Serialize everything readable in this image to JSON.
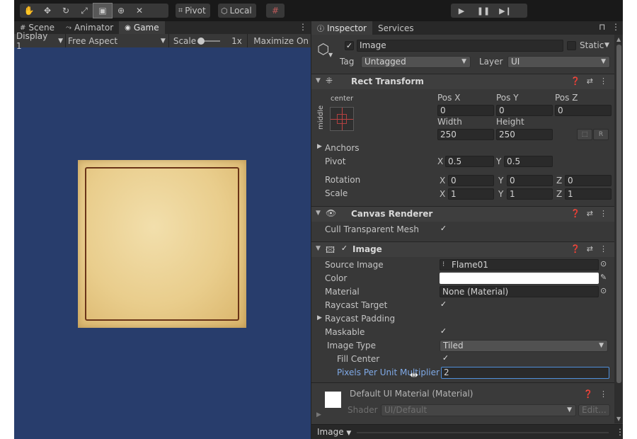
{
  "toolbar": {
    "pivot_label": "Pivot",
    "local_label": "Local"
  },
  "left_tabs": [
    {
      "label": "Scene",
      "icon": "grid-icon"
    },
    {
      "label": "Animator",
      "icon": "animator-icon"
    },
    {
      "label": "Game",
      "icon": "gamepad-icon"
    }
  ],
  "game_toolbar": {
    "display": "Display 1",
    "aspect": "Free Aspect",
    "scale_label": "Scale",
    "scale_value": "1x",
    "maximize": "Maximize On"
  },
  "inspector_tabs": [
    {
      "label": "Inspector",
      "icon": "info-icon"
    },
    {
      "label": "Services"
    }
  ],
  "object": {
    "name": "Image",
    "static_label": "Static",
    "tag_label": "Tag",
    "tag_value": "Untagged",
    "layer_label": "Layer",
    "layer_value": "UI"
  },
  "rect_transform": {
    "title": "Rect Transform",
    "anchor_h": "center",
    "anchor_v": "middle",
    "posx_label": "Pos X",
    "posx": "0",
    "posy_label": "Pos Y",
    "posy": "0",
    "posz_label": "Pos Z",
    "posz": "0",
    "width_label": "Width",
    "width": "250",
    "height_label": "Height",
    "height": "250",
    "r_button": "R",
    "anchors_label": "Anchors",
    "pivot_label": "Pivot",
    "pivot_x_label": "X",
    "pivot_x": "0.5",
    "pivot_y_label": "Y",
    "pivot_y": "0.5",
    "rotation_label": "Rotation",
    "rot_x": "0",
    "rot_y": "0",
    "rot_z": "0",
    "scale_label": "Scale",
    "scale_x": "1",
    "scale_y": "1",
    "scale_z": "1",
    "x": "X",
    "y": "Y",
    "z": "Z"
  },
  "canvas_renderer": {
    "title": "Canvas Renderer",
    "cull_label": "Cull Transparent Mesh"
  },
  "image_component": {
    "title": "Image",
    "source_label": "Source Image",
    "source_value": "Flame01",
    "color_label": "Color",
    "color_value": "#ffffff",
    "material_label": "Material",
    "material_value": "None (Material)",
    "raycast_target_label": "Raycast Target",
    "raycast_padding_label": "Raycast Padding",
    "maskable_label": "Maskable",
    "image_type_label": "Image Type",
    "image_type_value": "Tiled",
    "fill_center_label": "Fill Center",
    "ppu_label": "Pixels Per Unit Multiplier",
    "ppu_value": "2"
  },
  "material_panel": {
    "title": "Default UI Material (Material)",
    "shader_label": "Shader",
    "shader_value": "UI/Default",
    "edit_label": "Edit..."
  },
  "bottom_bar": {
    "label": "Image"
  },
  "colors": {
    "game_bg": "#283D6C",
    "parchment": "#E9CD8C",
    "frame": "#6A3418",
    "inspector_bg": "#383838",
    "accent": "#7FA9E6"
  }
}
